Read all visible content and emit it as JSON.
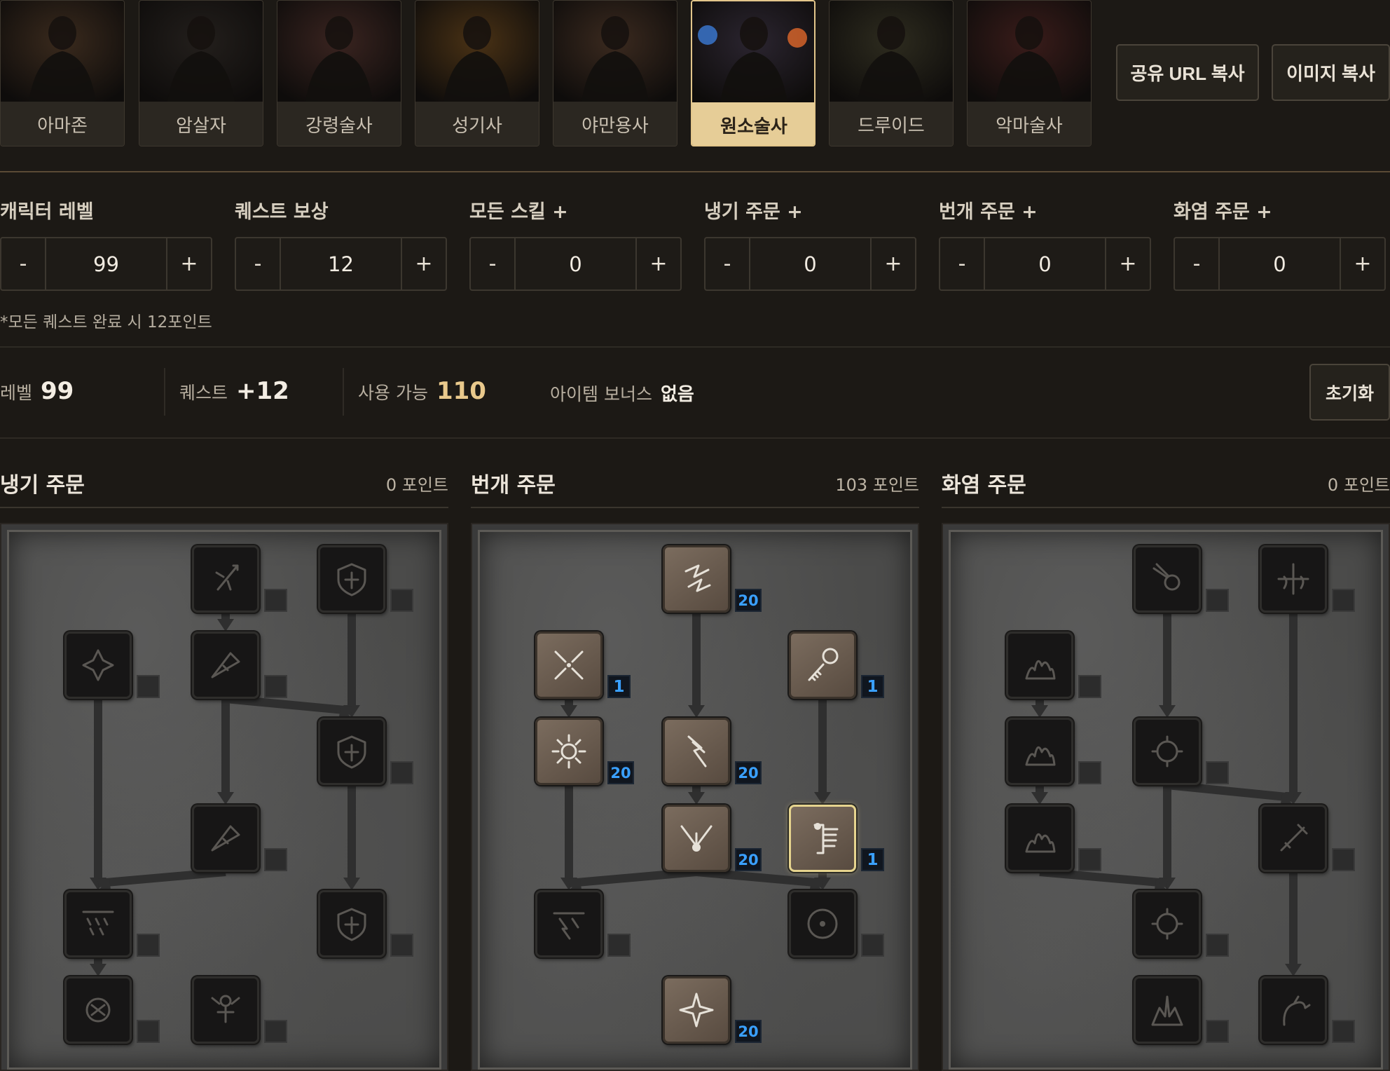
{
  "classes": [
    {
      "label": "아마존",
      "tint": "#3a2a1d"
    },
    {
      "label": "암살자",
      "tint": "#231f1c"
    },
    {
      "label": "강령술사",
      "tint": "#3a2420"
    },
    {
      "label": "성기사",
      "tint": "#4a3215"
    },
    {
      "label": "야만용사",
      "tint": "#3b2a1f"
    },
    {
      "label": "원소술사",
      "tint": "#2b2530",
      "active": true
    },
    {
      "label": "드루이드",
      "tint": "#2e2c1f"
    },
    {
      "label": "악마술사",
      "tint": "#3a1c1a"
    }
  ],
  "buttons": {
    "share_url": "공유 URL 복사",
    "copy_image": "이미지 복사",
    "reset": "초기화"
  },
  "controls": [
    {
      "label": "캐릭터 레벨",
      "value": "99"
    },
    {
      "label": "퀘스트 보상",
      "value": "12"
    },
    {
      "label": "모든 스킬 +",
      "value": "0"
    },
    {
      "label": "냉기 주문 +",
      "value": "0"
    },
    {
      "label": "번개 주문 +",
      "value": "0"
    },
    {
      "label": "화염 주문 +",
      "value": "0"
    }
  ],
  "stepper": {
    "minus": "-",
    "plus": "+"
  },
  "note": "*모든 퀘스트 완료 시 12포인트",
  "summary": {
    "level_label": "레벨",
    "level_value": "99",
    "quest_label": "퀘스트",
    "quest_value": "+12",
    "available_label": "사용 가능",
    "available_value": "110",
    "item_label": "아이템 보너스",
    "item_value": "없음"
  },
  "trees": [
    {
      "title": "냉기 주문",
      "points": "0 포인트"
    },
    {
      "title": "번개 주문",
      "points": "103 포인트"
    },
    {
      "title": "화염 주문",
      "points": "0 포인트"
    }
  ],
  "skills": {
    "cold": [
      {
        "icon": "ice-bolt-icon",
        "level": ""
      },
      {
        "icon": "frozen-armor-icon",
        "level": ""
      },
      {
        "icon": "frost-nova-icon",
        "level": ""
      },
      {
        "icon": "ice-blast-icon",
        "level": ""
      },
      {
        "icon": "shiver-armor-icon",
        "level": ""
      },
      {
        "icon": "glacial-spike-icon",
        "level": ""
      },
      {
        "icon": "blizzard-icon",
        "level": ""
      },
      {
        "icon": "chilling-armor-icon",
        "level": ""
      },
      {
        "icon": "frozen-orb-icon",
        "level": ""
      },
      {
        "icon": "cold-mastery-icon",
        "level": ""
      }
    ],
    "lightning": [
      {
        "icon": "charged-bolt-icon",
        "level": "20"
      },
      {
        "icon": "static-field-icon",
        "level": "1"
      },
      {
        "icon": "telekinesis-icon",
        "level": "1"
      },
      {
        "icon": "nova-icon",
        "level": "20"
      },
      {
        "icon": "lightning-icon",
        "level": "20"
      },
      {
        "icon": "chain-lightning-icon",
        "level": "20"
      },
      {
        "icon": "teleport-icon",
        "level": "1"
      },
      {
        "icon": "thunder-storm-icon",
        "level": ""
      },
      {
        "icon": "energy-shield-icon",
        "level": ""
      },
      {
        "icon": "lightning-mastery-icon",
        "level": "20"
      }
    ],
    "fire": [
      {
        "icon": "fire-bolt-icon",
        "level": ""
      },
      {
        "icon": "warmth-icon",
        "level": ""
      },
      {
        "icon": "inferno-icon",
        "level": ""
      },
      {
        "icon": "blaze-icon",
        "level": ""
      },
      {
        "icon": "fire-ball-icon",
        "level": ""
      },
      {
        "icon": "fire-wall-icon",
        "level": ""
      },
      {
        "icon": "enchant-icon",
        "level": ""
      },
      {
        "icon": "meteor-icon",
        "level": ""
      },
      {
        "icon": "fire-mastery-icon",
        "level": ""
      },
      {
        "icon": "hydra-icon",
        "level": ""
      }
    ]
  },
  "colors": {
    "accent": "#e6cd97",
    "available": "#e9c98c",
    "level_badge": "#3aa0ff",
    "divider": "#5a4a35"
  }
}
